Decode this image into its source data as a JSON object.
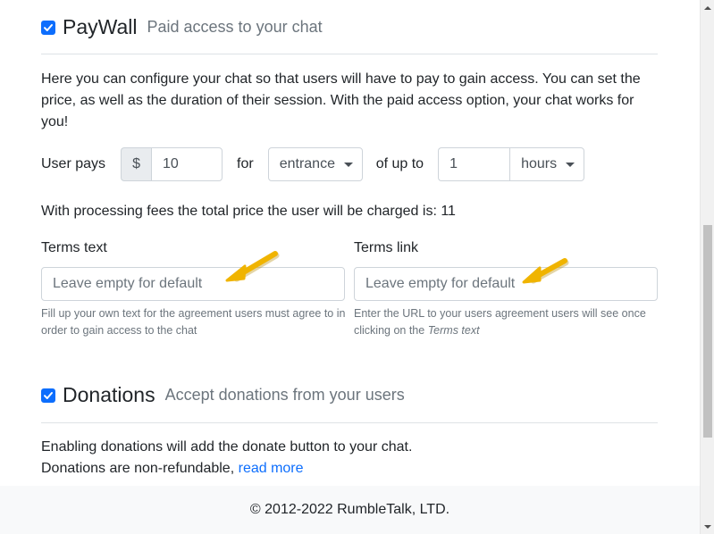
{
  "paywall": {
    "title": "PayWall",
    "subtitle": "Paid access to your chat",
    "description": "Here you can configure your chat so that users will have to pay to gain access. You can set the price, as well as the duration of their session. With the paid access option, your chat works for you!",
    "user_pays_label": "User pays",
    "currency_symbol": "$",
    "price_value": "10",
    "for_label": "for",
    "access_type": "entrance",
    "of_up_to_label": "of up to",
    "duration_value": "1",
    "duration_unit": "hours",
    "fees_note": "With processing fees the total price the user will be charged is: 11",
    "terms_text": {
      "label": "Terms text",
      "placeholder": "Leave empty for default",
      "help": "Fill up your own text for the agreement users must agree to in order to gain access to the chat"
    },
    "terms_link": {
      "label": "Terms link",
      "placeholder": "Leave empty for default",
      "help_prefix": "Enter the URL to your users agreement users will see once clicking on the ",
      "help_em": "Terms text"
    }
  },
  "donations": {
    "title": "Donations",
    "subtitle": "Accept donations from your users",
    "line1": "Enabling donations will add the donate button to your chat.",
    "line2": "Donations are non-refundable,",
    "read_more": "read more"
  },
  "footer": {
    "copyright": "© 2012-2022 RumbleTalk, LTD."
  },
  "colors": {
    "accent": "#0d6efd",
    "arrow": "#f0b400"
  },
  "icons": [
    "check-icon",
    "caret-down-icon",
    "annotation-arrow-icon",
    "scroll-up-icon",
    "scroll-down-icon"
  ]
}
